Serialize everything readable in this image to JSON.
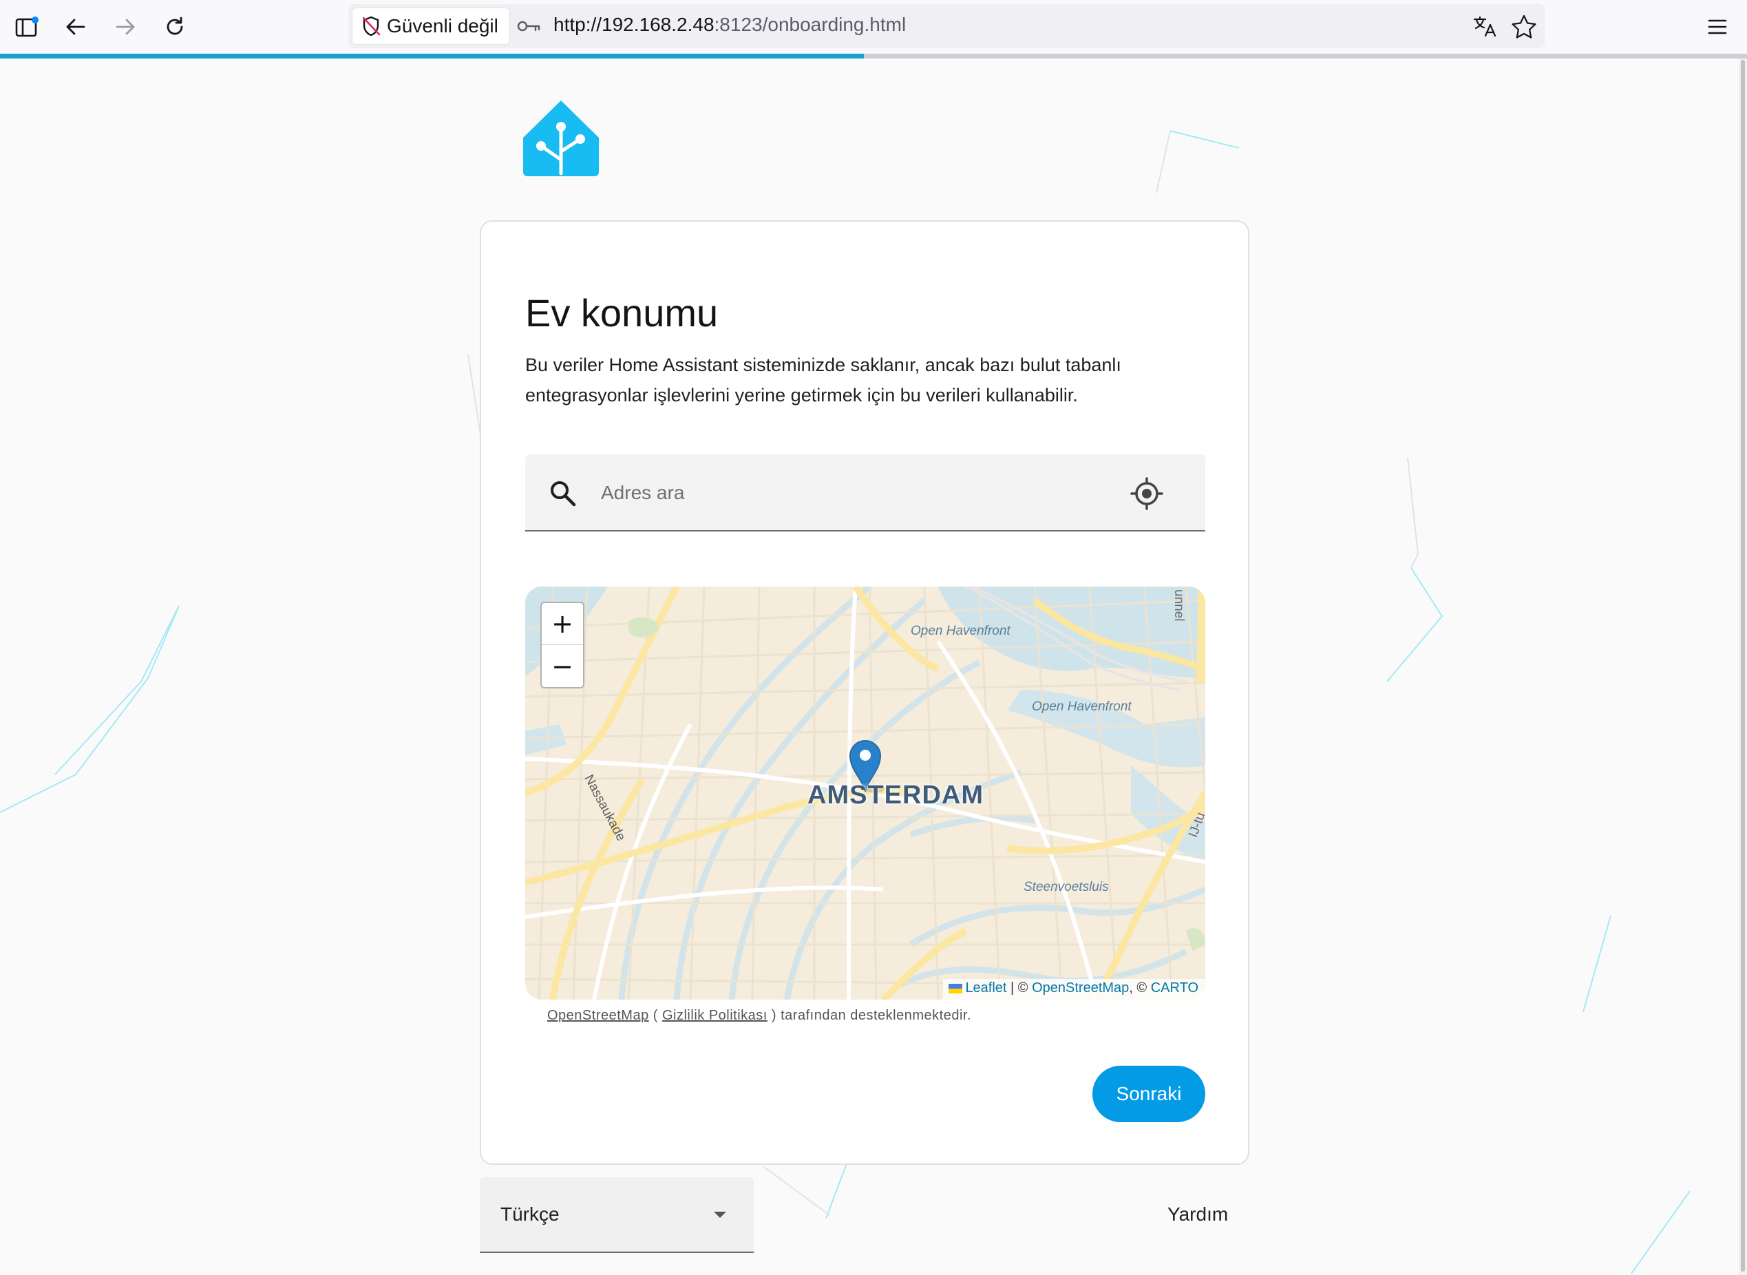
{
  "browser": {
    "security_label": "Güvenli değil",
    "url_host": "http://192.168.2.48",
    "url_rest": ":8123/onboarding.html",
    "accent": "#1a9fce"
  },
  "onboarding": {
    "title": "Ev konumu",
    "description": "Bu veriler Home Assistant sisteminizde saklanır, ancak bazı bulut tabanlı entegrasyonlar işlevlerini yerine getirmek için bu verileri kullanabilir.",
    "search": {
      "placeholder": "Adres ara",
      "value": ""
    },
    "map": {
      "zoom_in": "+",
      "zoom_out": "−",
      "city_label": "AMSTERDAM",
      "labels": {
        "havenfront_1": "Open Havenfront",
        "havenfront_2": "Open Havenfront",
        "steenvoetsluis": "Steenvoetsluis",
        "nassaukade": "Nassaukade",
        "tunnel": "unnel",
        "ij": "IJ-tu"
      },
      "attribution": {
        "leaflet": "Leaflet",
        "sep1": " | © ",
        "osm": "OpenStreetMap",
        "sep2": ", © ",
        "carto": "CARTO"
      }
    },
    "osm_note": {
      "osm_link": "OpenStreetMap",
      "open_paren": " ( ",
      "privacy_link": "Gizlilik Politikası",
      "rest": " ) tarafından desteklenmektedir."
    },
    "next_button": "Sonraki",
    "brand_color": "#18bcf2"
  },
  "footer": {
    "language": "Türkçe",
    "help": "Yardım"
  }
}
